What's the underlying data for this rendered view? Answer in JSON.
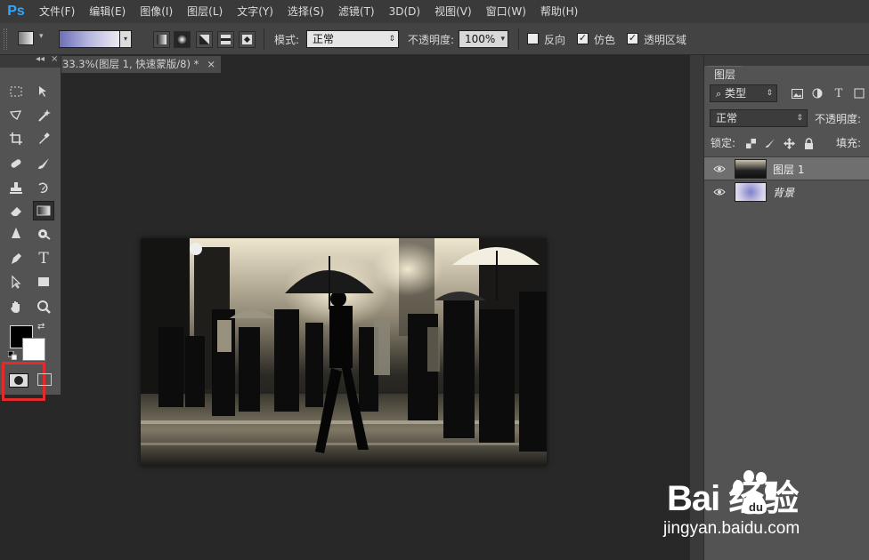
{
  "app": {
    "logo": "Ps"
  },
  "menu": [
    "文件(F)",
    "编辑(E)",
    "图像(I)",
    "图层(L)",
    "文字(Y)",
    "选择(S)",
    "滤镜(T)",
    "3D(D)",
    "视图(V)",
    "窗口(W)",
    "帮助(H)"
  ],
  "options": {
    "mode_label": "模式:",
    "mode_value": "正常",
    "opacity_label": "不透明度:",
    "opacity_value": "100%",
    "reverse_label": "反向",
    "reverse_checked": false,
    "dither_label": "仿色",
    "dither_checked": true,
    "transparency_label": "透明区域",
    "transparency_checked": true,
    "gradient_colors": [
      "#6d6fb8",
      "#b8b9e0",
      "#efeaf0"
    ]
  },
  "document": {
    "tab_title": "33.3%(图层 1, 快速蒙版/8) *",
    "close_symbol": "×"
  },
  "toolbox": {
    "collapse_symbol": "◂◂",
    "close_symbol": "×",
    "foreground_color": "#000000",
    "background_color": "#ffffff",
    "highlight_color": "#e42a2a",
    "text_tool_glyph": "T"
  },
  "layers_panel": {
    "tab_label": "图层",
    "filter_label": "类型",
    "blend_mode": "正常",
    "opacity_label": "不透明度:",
    "lock_label": "锁定:",
    "fill_label": "填充:",
    "layers": [
      {
        "name": "图层 1",
        "selected": true,
        "visible": true
      },
      {
        "name": "背景",
        "selected": false,
        "visible": true
      }
    ]
  },
  "watermark": {
    "brand": "Bai  经验",
    "site": "jingyan.baidu.com"
  }
}
